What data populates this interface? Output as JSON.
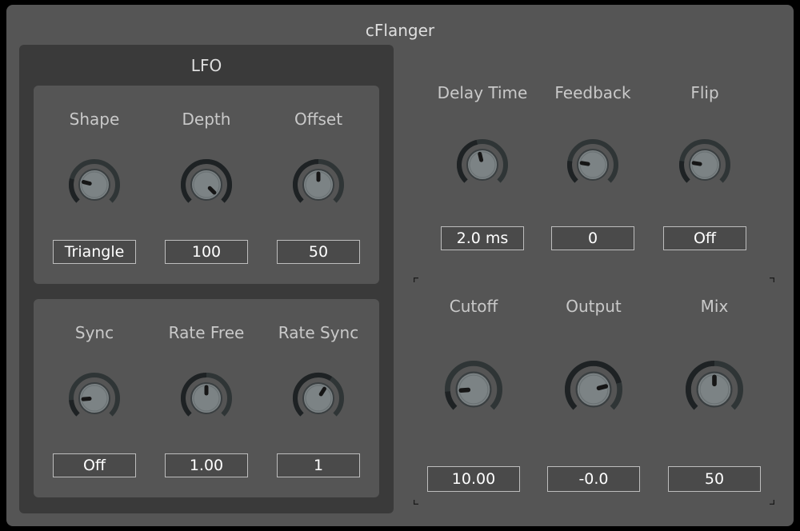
{
  "plugin": {
    "title": "cFlanger"
  },
  "lfo": {
    "title": "LFO",
    "shape": {
      "label": "Shape",
      "value": "Triangle",
      "level": 0.22
    },
    "depth": {
      "label": "Depth",
      "value": "100",
      "level": 1.0
    },
    "offset": {
      "label": "Offset",
      "value": "50",
      "level": 0.5
    },
    "sync": {
      "label": "Sync",
      "value": "Off",
      "level": 0.15
    },
    "rate_free": {
      "label": "Rate Free",
      "value": "1.00",
      "level": 0.5
    },
    "rate_sync": {
      "label": "Rate Sync",
      "value": "1",
      "level": 0.62
    }
  },
  "main": {
    "delay_time": {
      "label": "Delay Time",
      "value": "2.0 ms",
      "level": 0.45
    },
    "feedback": {
      "label": "Feedback",
      "value": "0",
      "level": 0.2
    },
    "flip": {
      "label": "Flip",
      "value": "Off",
      "level": 0.2
    },
    "cutoff": {
      "label": "Cutoff",
      "value": "10.00",
      "level": 0.15
    },
    "output": {
      "label": "Output",
      "value": "-0.0",
      "level": 0.78
    },
    "mix": {
      "label": "Mix",
      "value": "50",
      "level": 0.5
    }
  },
  "colors": {
    "panel": "#555555",
    "frame": "#3a3a3a",
    "knob_track": "#2f3536",
    "knob_arc": "#1e2224",
    "knob_body": "#7c8385"
  }
}
